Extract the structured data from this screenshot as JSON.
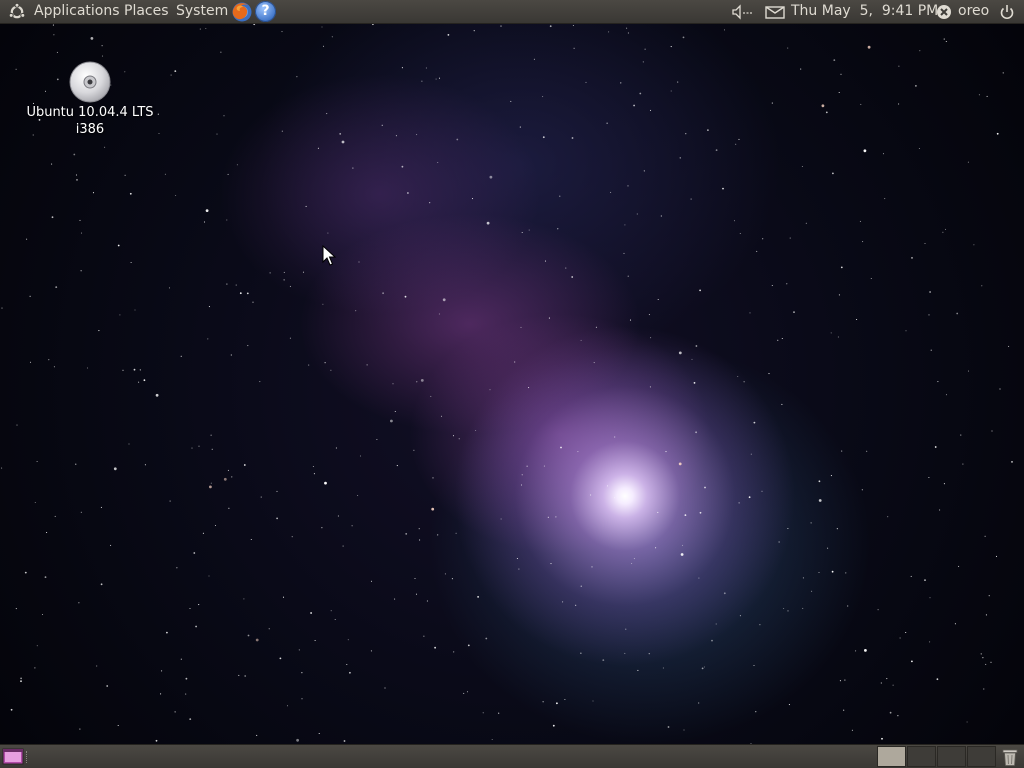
{
  "top_panel": {
    "menus": [
      "Applications",
      "Places",
      "System"
    ],
    "clock": "Thu May  5,  9:41 PM",
    "user": "oreo",
    "launchers": {
      "browser": "firefox-icon",
      "help": "help-icon",
      "help_glyph": "?"
    },
    "indicators": [
      "volume-icon",
      "mail-icon",
      "user-status-icon",
      "power-icon"
    ]
  },
  "desktop": {
    "icon_label_line1": "Ubuntu 10.04.4 LTS",
    "icon_label_line2": "i386",
    "icon": "cdrom-icon"
  },
  "bottom_panel": {
    "workspaces": 4,
    "active_workspace": 1,
    "items": [
      "show-desktop-icon",
      "trash-icon"
    ]
  },
  "colors": {
    "panel": "#3f3d39",
    "panel_text": "#dfdbd2",
    "active_workspace": "#aea89c"
  }
}
